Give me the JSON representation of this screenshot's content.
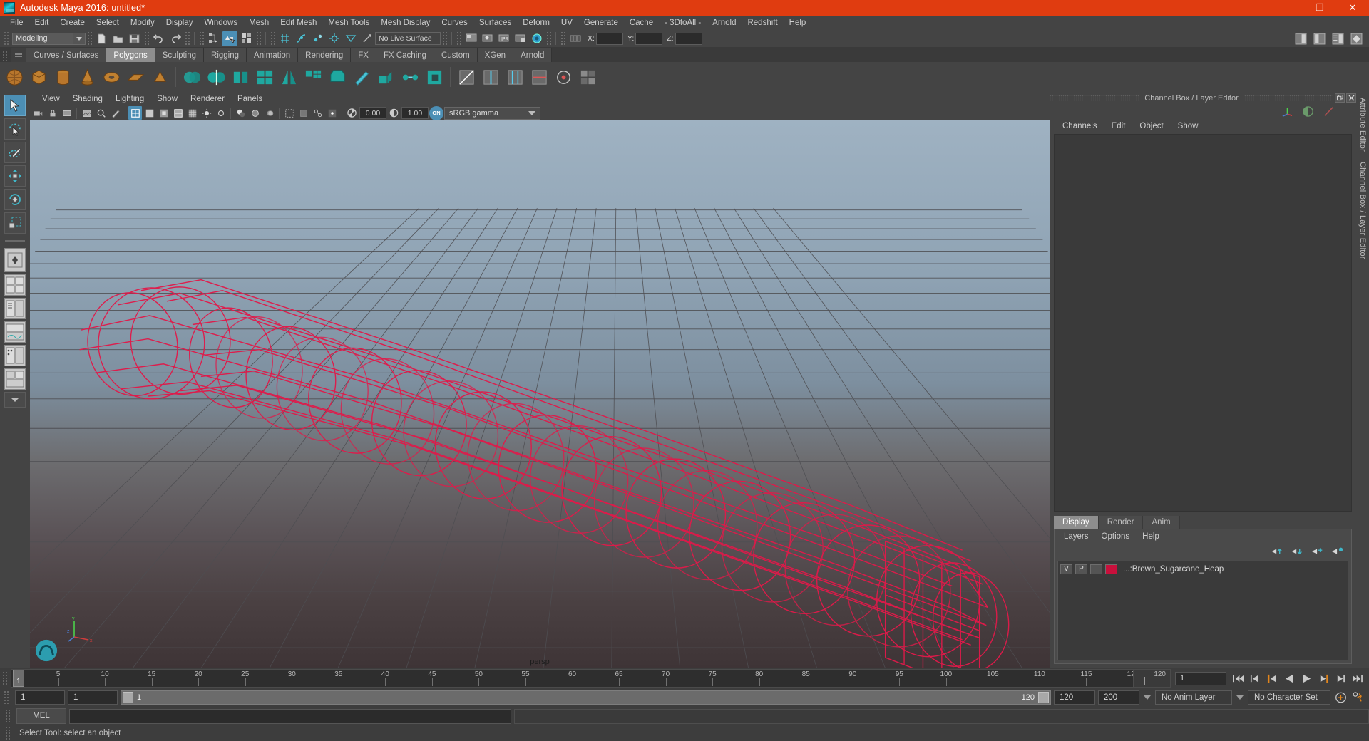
{
  "window": {
    "title": "Autodesk Maya 2016: untitled*",
    "logo_icon": "maya-logo-icon",
    "minimize_label": "–",
    "maximize_label": "❐",
    "close_label": "✕"
  },
  "menubar": {
    "items": [
      {
        "label": "File"
      },
      {
        "label": "Edit"
      },
      {
        "label": "Create"
      },
      {
        "label": "Select"
      },
      {
        "label": "Modify"
      },
      {
        "label": "Display"
      },
      {
        "label": "Windows"
      },
      {
        "label": "Mesh"
      },
      {
        "label": "Edit Mesh"
      },
      {
        "label": "Mesh Tools"
      },
      {
        "label": "Mesh Display"
      },
      {
        "label": "Curves"
      },
      {
        "label": "Surfaces"
      },
      {
        "label": "Deform"
      },
      {
        "label": "UV"
      },
      {
        "label": "Generate"
      },
      {
        "label": "Cache"
      },
      {
        "label": "- 3DtoAll -"
      },
      {
        "label": "Arnold"
      },
      {
        "label": "Redshift"
      },
      {
        "label": "Help"
      }
    ]
  },
  "statusline": {
    "mode_value": "Modeling",
    "live_surface": "No Live Surface",
    "x_label": "X:",
    "y_label": "Y:",
    "z_label": "Z:",
    "x_value": "",
    "y_value": "",
    "z_value": ""
  },
  "shelf": {
    "tabs": [
      {
        "label": "Curves / Surfaces",
        "active": false
      },
      {
        "label": "Polygons",
        "active": true
      },
      {
        "label": "Sculpting",
        "active": false
      },
      {
        "label": "Rigging",
        "active": false
      },
      {
        "label": "Animation",
        "active": false
      },
      {
        "label": "Rendering",
        "active": false
      },
      {
        "label": "FX",
        "active": false
      },
      {
        "label": "FX Caching",
        "active": false
      },
      {
        "label": "Custom",
        "active": false
      },
      {
        "label": "XGen",
        "active": false
      },
      {
        "label": "Arnold",
        "active": false
      }
    ]
  },
  "viewport": {
    "menu": [
      {
        "label": "View"
      },
      {
        "label": "Shading"
      },
      {
        "label": "Lighting"
      },
      {
        "label": "Show"
      },
      {
        "label": "Renderer"
      },
      {
        "label": "Panels"
      }
    ],
    "exposure_value": "0.00",
    "gamma_value": "1.00",
    "color_management_toggle": "ON",
    "color_profile": "sRGB gamma",
    "camera_label": "persp",
    "mesh_wireframe_color": "#e01a4a",
    "grid_color": "#4a4a4a"
  },
  "channelbox": {
    "panel_title": "Channel Box / Layer Editor",
    "menu": [
      {
        "label": "Channels"
      },
      {
        "label": "Edit"
      },
      {
        "label": "Object"
      },
      {
        "label": "Show"
      }
    ],
    "restore_icon": "restore-panel-icon",
    "close_icon": "close-panel-icon"
  },
  "layer_editor": {
    "tabs": [
      {
        "label": "Display",
        "active": true
      },
      {
        "label": "Render",
        "active": false
      },
      {
        "label": "Anim",
        "active": false
      }
    ],
    "menu": [
      {
        "label": "Layers"
      },
      {
        "label": "Options"
      },
      {
        "label": "Help"
      }
    ],
    "layers": [
      {
        "visibility": "V",
        "playback": "P",
        "shading": "",
        "color": "#c8103c",
        "name": "...:Brown_Sugarcane_Heap"
      }
    ]
  },
  "right_vtabs": [
    {
      "label": "Attribute Editor"
    },
    {
      "label": "Channel Box / Layer Editor"
    }
  ],
  "timeline": {
    "start_frame": "1",
    "end_frame": "120",
    "current_frame": "1",
    "ticks": [
      5,
      10,
      15,
      20,
      25,
      30,
      35,
      40,
      45,
      50,
      55,
      60,
      65,
      70,
      75,
      80,
      85,
      90,
      95,
      100,
      105,
      110,
      115,
      120
    ],
    "frame_field": "1",
    "playback_buttons": [
      {
        "name": "go-to-start-icon"
      },
      {
        "name": "step-back-keyframe-icon"
      },
      {
        "name": "step-back-frame-icon"
      },
      {
        "name": "play-backwards-icon"
      },
      {
        "name": "play-forwards-icon"
      },
      {
        "name": "step-forward-frame-icon"
      },
      {
        "name": "step-forward-keyframe-icon"
      },
      {
        "name": "go-to-end-icon"
      }
    ]
  },
  "rangeslider": {
    "anim_start": "1",
    "playback_start": "1",
    "bar_start_label": "1",
    "bar_end_label": "120",
    "playback_end": "120",
    "anim_end": "200",
    "anim_layer": "No Anim Layer",
    "character_set": "No Character Set",
    "auto_key_icon": "auto-keyframe-icon",
    "anim_prefs_icon": "animation-preferences-icon"
  },
  "commandline": {
    "language_label": "MEL",
    "input_value": "",
    "output_value": ""
  },
  "helpline": {
    "message": "Select Tool: select an object"
  },
  "toolbox": {
    "items": [
      {
        "name": "select-tool-icon",
        "selected": true
      },
      {
        "name": "lasso-select-tool-icon",
        "selected": false
      },
      {
        "name": "paint-select-tool-icon",
        "selected": false
      },
      {
        "name": "move-tool-icon",
        "selected": false
      },
      {
        "name": "rotate-tool-icon",
        "selected": false
      },
      {
        "name": "scale-tool-icon",
        "selected": false
      }
    ],
    "layouts": [
      {
        "name": "single-pane-layout-icon"
      },
      {
        "name": "four-pane-layout-icon"
      },
      {
        "name": "outliner-persp-layout-icon"
      },
      {
        "name": "persp-graph-layout-icon"
      },
      {
        "name": "hypershade-persp-layout-icon"
      },
      {
        "name": "persp-graph-outliner-layout-icon"
      }
    ]
  }
}
